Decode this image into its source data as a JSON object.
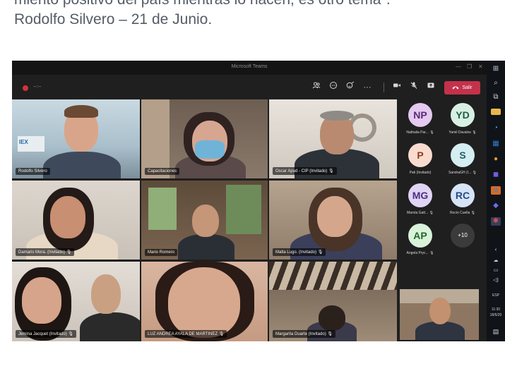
{
  "caption": {
    "line1": "miento positivo del país mientras lo hacen, es otro tema\".",
    "line2": "Rodolfo Silvero – 21 de Junio."
  },
  "window": {
    "title": "Microsoft Teams",
    "min": "—",
    "max": "❐",
    "close": "✕"
  },
  "toolbar": {
    "timer": "--:--",
    "leave_label": "Salir",
    "icons": {
      "participants": "participants-icon",
      "chat": "chat-icon",
      "reactions": "reactions-icon",
      "more": "more-icon",
      "camera": "camera-icon",
      "mic": "mic-off-icon",
      "share": "share-icon",
      "leave": "phone-icon"
    }
  },
  "participants": [
    {
      "name": "Rodolfo Silvero",
      "muted": false
    },
    {
      "name": "Capacitaciones",
      "muted": false
    },
    {
      "name": "Oscar Apud - CIP (Invitado)",
      "muted": true
    },
    {
      "name": "Damaris Mora. (Invitado)",
      "muted": true
    },
    {
      "name": "Mario Romero",
      "muted": false
    },
    {
      "name": "Malta Lugo. (Invitado)",
      "muted": true
    },
    {
      "name": "Jemina Jacquet (Invitado)",
      "muted": true
    },
    {
      "name": "LUZ ANDREA AYALA DE MARTINEZ",
      "muted": true
    },
    {
      "name": "Margarita Duarte (Invitado)",
      "muted": true
    }
  ],
  "side_participants": [
    {
      "initials": "NP",
      "name": "Nathalia Par...",
      "color": "#e4c9f0",
      "text_color": "#5b2a75"
    },
    {
      "initials": "YD",
      "name": "Yamil Davalos",
      "color": "#d8f0e4",
      "text_color": "#1e5e45"
    },
    {
      "initials": "P",
      "name": "Pati (Invitado)",
      "color": "#f9dccf",
      "text_color": "#8a3f1d"
    },
    {
      "initials": "S",
      "name": "SandraGH (I...",
      "color": "#d4eef2",
      "text_color": "#1f5f6a"
    },
    {
      "initials": "MG",
      "name": "Marola Gatt...",
      "color": "#e0d4f4",
      "text_color": "#4b2f80"
    },
    {
      "initials": "RC",
      "name": "Rocio Cuella",
      "color": "#d6e4f8",
      "text_color": "#274a84"
    },
    {
      "initials": "AP",
      "name": "Angela Pryc...",
      "color": "#d9f2da",
      "text_color": "#23652a"
    }
  ],
  "more_count": "+10",
  "taskbar": {
    "language": "ESP",
    "time": "11:30",
    "date": "18/6/20"
  },
  "colors": {
    "leave": "#c4314b",
    "active_speaker": "#7f85f5",
    "record": "#d13438"
  }
}
